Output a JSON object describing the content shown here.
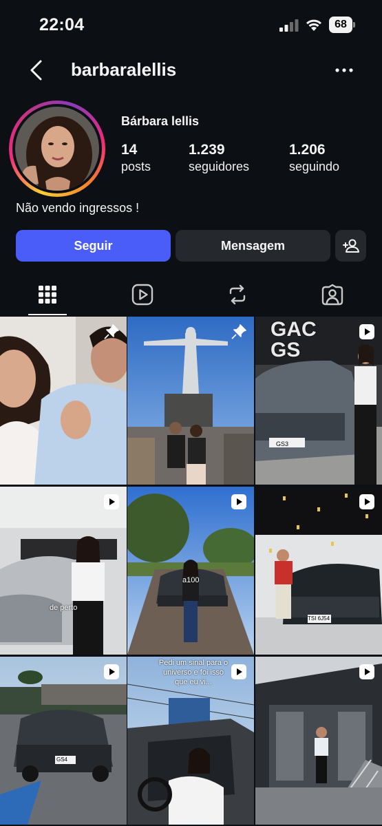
{
  "status_bar": {
    "time": "22:04",
    "battery": "68"
  },
  "header": {
    "username": "barbaralellis"
  },
  "profile": {
    "full_name": "Bárbara lellis",
    "stats": [
      {
        "value": "14",
        "label": "posts"
      },
      {
        "value": "1.239",
        "label": "seguidores"
      },
      {
        "value": "1.206",
        "label": "seguindo"
      }
    ],
    "bio": "Não vendo ingressos !"
  },
  "actions": {
    "follow_label": "Seguir",
    "message_label": "Mensagem"
  },
  "tabs": [
    {
      "icon": "grid-icon",
      "active": true
    },
    {
      "icon": "reels-icon",
      "active": false
    },
    {
      "icon": "reposts-icon",
      "active": false
    },
    {
      "icon": "tagged-icon",
      "active": false
    }
  ],
  "posts": [
    {
      "badge": "pin-icon"
    },
    {
      "badge": "pin-icon"
    },
    {
      "badge": "reel-icon",
      "sign_text": "GAC GS",
      "plate_text": "GS3"
    },
    {
      "badge": "reel-icon",
      "caption": "de perto"
    },
    {
      "badge": "reel-icon",
      "caption": "a100"
    },
    {
      "badge": "reel-icon",
      "plate_text": "TSI 6J54"
    },
    {
      "badge": "reel-icon",
      "plate_text": "GS4"
    },
    {
      "badge": "reel-icon",
      "caption": "Pedi um sinal para o universo e foi isso que eu vi..."
    },
    {
      "badge": "reel-icon"
    }
  ],
  "colors": {
    "background": "#0c1014",
    "follow": "#4a5df9",
    "secondary_button": "#25292e"
  }
}
